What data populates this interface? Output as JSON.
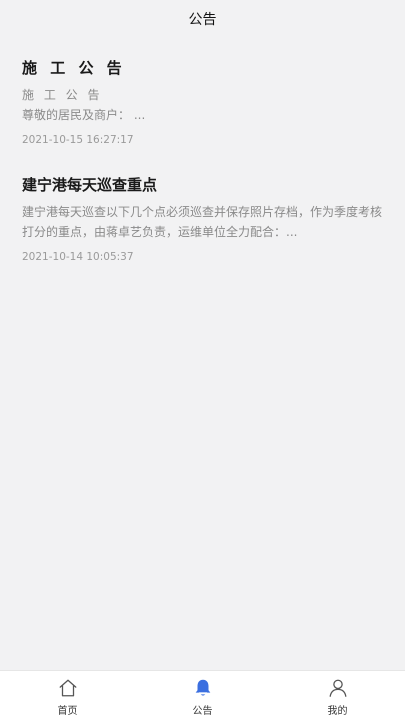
{
  "header": {
    "title": "公告"
  },
  "notices": [
    {
      "title": "施 工 公 告",
      "subtitle": "施 工 公 告",
      "excerpt": "尊敬的居民及商户：  ...",
      "time": "2021-10-15 16:27:17"
    },
    {
      "title": "建宁港每天巡查重点",
      "excerpt": "建宁港每天巡查以下几个点必须巡查并保存照片存档，作为季度考核打分的重点，由蒋卓艺负责，运维单位全力配合：...",
      "time": "2021-10-14 10:05:37"
    }
  ],
  "tabbar": {
    "items": [
      {
        "label": "首页",
        "icon": "home-icon"
      },
      {
        "label": "公告",
        "icon": "bell-icon",
        "active": true
      },
      {
        "label": "我的",
        "icon": "user-icon"
      }
    ],
    "active_color": "#3b6fe0",
    "inactive_color": "#555555"
  }
}
